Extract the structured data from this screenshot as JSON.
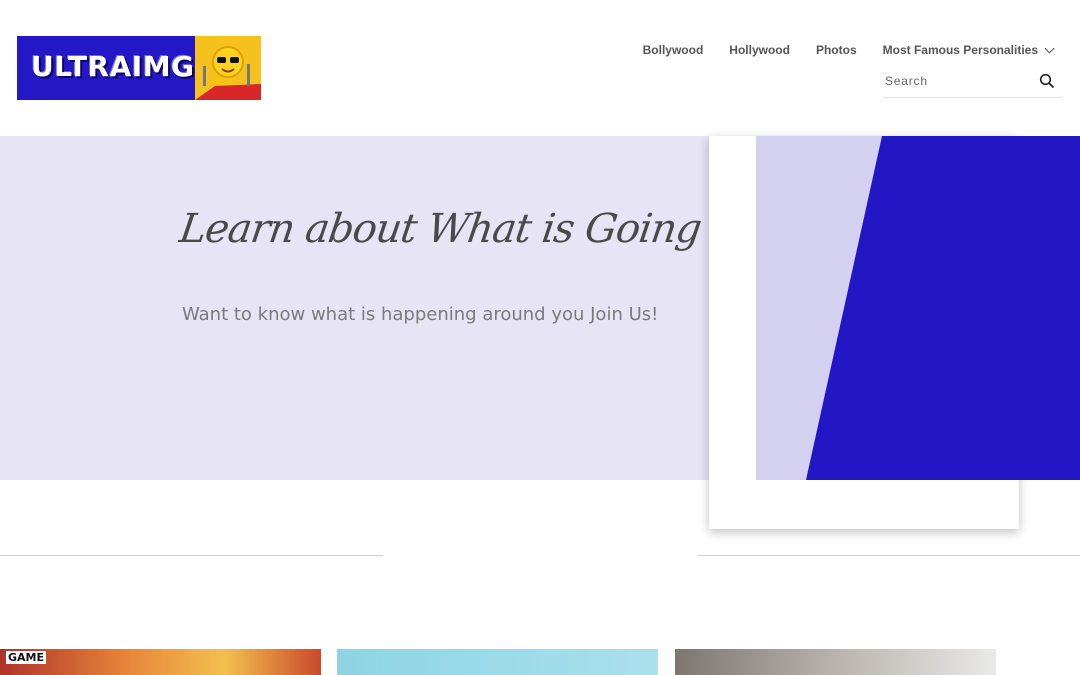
{
  "logo": {
    "text": "ULTRAIMG"
  },
  "nav": {
    "items": [
      {
        "label": "Bollywood"
      },
      {
        "label": "Hollywood"
      },
      {
        "label": "Photos"
      },
      {
        "label": "Most Famous Personalities"
      }
    ]
  },
  "search": {
    "placeholder": "Search",
    "icon": "search-icon"
  },
  "hero": {
    "title": "Learn about What is Going On!",
    "subtitle": "Want to know what is happening around you Join Us!"
  },
  "thumbnails": [
    {
      "label": "GAME"
    },
    {
      "label": ""
    },
    {
      "label": ""
    }
  ],
  "colors": {
    "brand_blue": "#2316c4",
    "hero_bg": "#e6e4f5",
    "panel_light": "#d3d1ef"
  }
}
